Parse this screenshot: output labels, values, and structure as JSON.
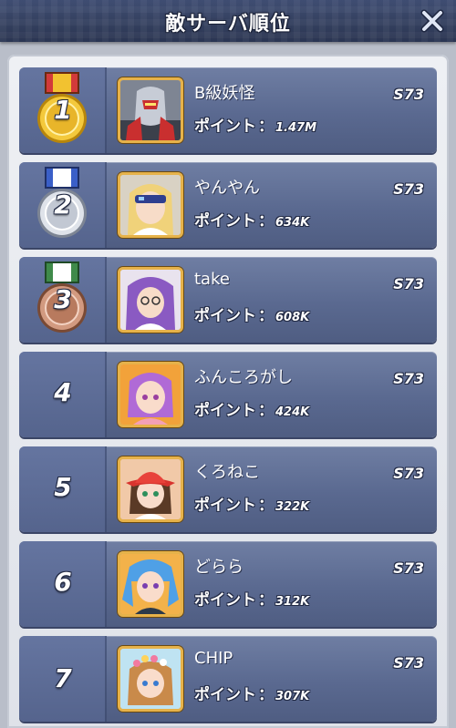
{
  "header": {
    "title": "敵サーバ順位",
    "close_icon": "close-x-icon"
  },
  "colors": {
    "gold": "#e6b424",
    "silver": "#c6ccd6",
    "bronze": "#b87a5e",
    "row": "#5c6b92",
    "accent_blue": "#3a5fc8",
    "accent_green": "#3f8a4a",
    "accent_red": "#d23a3a"
  },
  "ranking": {
    "points_label": "ポイント",
    "colon": "：",
    "rows": [
      {
        "rank": "1",
        "medal": "gold",
        "name": "B級妖怪",
        "server": "S73",
        "points": "1.47M",
        "avatar": "armored-hero-avatar"
      },
      {
        "rank": "2",
        "medal": "silver",
        "name": "やんやん",
        "server": "S73",
        "points": "634K",
        "avatar": "blonde-visor-girl-avatar"
      },
      {
        "rank": "3",
        "medal": "bronze",
        "name": "take",
        "server": "S73",
        "points": "608K",
        "avatar": "purple-hair-glasses-avatar"
      },
      {
        "rank": "4",
        "medal": "",
        "name": "ふんころがし",
        "server": "S73",
        "points": "424K",
        "avatar": "purple-hair-girl-avatar"
      },
      {
        "rank": "5",
        "medal": "",
        "name": "くろねこ",
        "server": "S73",
        "points": "322K",
        "avatar": "red-hat-girl-avatar"
      },
      {
        "rank": "6",
        "medal": "",
        "name": "どらら",
        "server": "S73",
        "points": "312K",
        "avatar": "blue-twin-tail-avatar"
      },
      {
        "rank": "7",
        "medal": "",
        "name": "CHIP",
        "server": "S73",
        "points": "307K",
        "avatar": "flower-crown-girl-avatar"
      }
    ]
  }
}
